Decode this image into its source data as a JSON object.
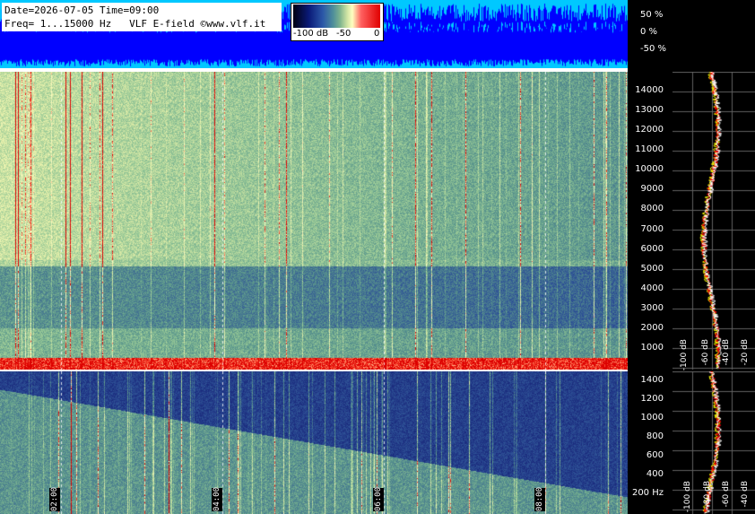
{
  "header": {
    "line1": "Date=2026-07-05 Time=09:00",
    "line2": "Freq= 1...15000 Hz   VLF E-field ©www.vlf.it"
  },
  "colorbar": {
    "labels": [
      "-100 dB",
      "-50",
      "0"
    ],
    "colors": [
      "#000010",
      "#2b57a8",
      "#7fb48e",
      "#ffffc0",
      "#e00000"
    ]
  },
  "waveform": {
    "scale_labels": [
      "50 %",
      "0 %",
      "-50 %"
    ],
    "background_color": "#00c8ff",
    "trace_color": "#0000ff"
  },
  "spectrogram_upper": {
    "freq_labels": [
      "14000",
      "13000",
      "12000",
      "11000",
      "10000",
      "9000",
      "8000",
      "7000",
      "6000",
      "5000",
      "4000",
      "3000",
      "2000",
      "1000"
    ]
  },
  "spectrogram_lower": {
    "freq_labels": [
      "1400",
      "1200",
      "1000",
      "800",
      "600",
      "400",
      "200 Hz"
    ]
  },
  "time_marks": [
    "02:00",
    "04:00",
    "06:00",
    "08:00"
  ],
  "spectrum_panel_upper": {
    "db_labels": [
      "-100 dB",
      "-60 dB",
      "-40 dB",
      "-20 dB"
    ]
  },
  "spectrum_panel_lower": {
    "db_labels": [
      "-100 dB",
      "-80 dB",
      "-60 dB",
      "-40 dB"
    ]
  }
}
